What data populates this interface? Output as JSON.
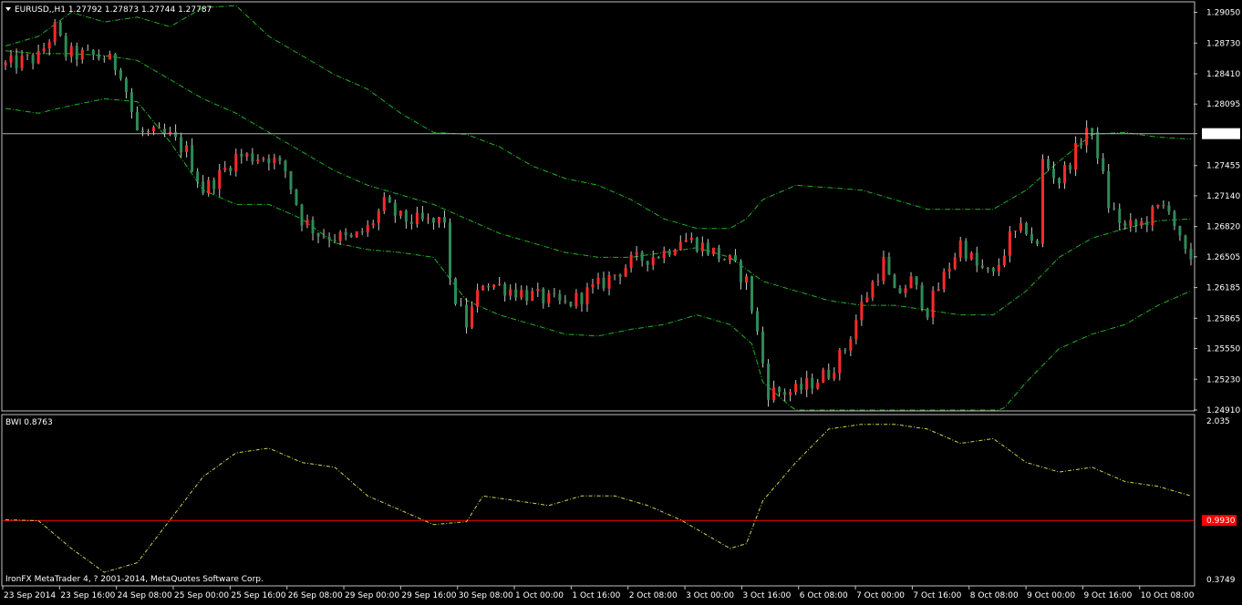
{
  "window": {
    "symbol_header": "EURUSD,,H1  1.27792 1.27873 1.27744 1.27787",
    "indicator_header": "BWI 0.8763",
    "copyright": "IronFX MetaTrader 4, ? 2001-2014, MetaQuotes Software Corp."
  },
  "colors": {
    "background": "#000000",
    "frame": "#c0c0c0",
    "bull_candle": "#ff2a2a",
    "bear_candle": "#2e8b57",
    "wick": "#c8c8c8",
    "bollinger": "#22b022",
    "bwi_line": "#c8d84a",
    "bwi_level": "#ff0000",
    "bid_line": "#b0b0b0"
  },
  "chart_data": [
    {
      "type": "candlestick",
      "title": "EURUSD,,H1",
      "ohlc_header": "1.27792 1.27873 1.27744 1.27787",
      "y_ticks": [
        "1.29050",
        "1.28730",
        "1.28410",
        "1.28095",
        "1.27787",
        "1.27455",
        "1.27140",
        "1.26820",
        "1.26505",
        "1.26185",
        "1.25865",
        "1.25550",
        "1.25230",
        "1.24910"
      ],
      "ylim": [
        1.2491,
        1.2915
      ],
      "current_price": 1.27787,
      "x_ticks": [
        "23 Sep 2014",
        "23 Sep 16:00",
        "24 Sep 08:00",
        "25 Sep 00:00",
        "25 Sep 16:00",
        "26 Sep 08:00",
        "29 Sep 00:00",
        "29 Sep 16:00",
        "30 Sep 08:00",
        "1 Oct 00:00",
        "1 Oct 16:00",
        "2 Oct 08:00",
        "3 Oct 00:00",
        "3 Oct 16:00",
        "6 Oct 08:00",
        "7 Oct 00:00",
        "7 Oct 16:00",
        "8 Oct 08:00",
        "9 Oct 00:00",
        "9 Oct 16:00",
        "10 Oct 08:00"
      ],
      "close_path": [
        [
          0,
          1.285
        ],
        [
          6,
          1.2858
        ],
        [
          9,
          1.2888
        ],
        [
          11,
          1.2862
        ],
        [
          18,
          1.2858
        ],
        [
          21,
          1.2845
        ],
        [
          24,
          1.278
        ],
        [
          30,
          1.2775
        ],
        [
          33,
          1.276
        ],
        [
          36,
          1.272
        ],
        [
          39,
          1.2735
        ],
        [
          42,
          1.2755
        ],
        [
          48,
          1.2755
        ],
        [
          51,
          1.274
        ],
        [
          54,
          1.269
        ],
        [
          57,
          1.2675
        ],
        [
          63,
          1.2668
        ],
        [
          66,
          1.268
        ],
        [
          69,
          1.2705
        ],
        [
          72,
          1.269
        ],
        [
          78,
          1.2685
        ],
        [
          80,
          1.269
        ],
        [
          81,
          1.262
        ],
        [
          84,
          1.258
        ],
        [
          87,
          1.2625
        ],
        [
          96,
          1.261
        ],
        [
          102,
          1.26
        ],
        [
          108,
          1.262
        ],
        [
          114,
          1.2645
        ],
        [
          120,
          1.2655
        ],
        [
          123,
          1.267
        ],
        [
          126,
          1.2665
        ],
        [
          132,
          1.2645
        ],
        [
          135,
          1.2625
        ],
        [
          137,
          1.257
        ],
        [
          139,
          1.251
        ],
        [
          144,
          1.251
        ],
        [
          150,
          1.253
        ],
        [
          153,
          1.2555
        ],
        [
          156,
          1.26
        ],
        [
          160,
          1.2645
        ],
        [
          162,
          1.261
        ],
        [
          165,
          1.2625
        ],
        [
          168,
          1.2595
        ],
        [
          171,
          1.263
        ],
        [
          174,
          1.2665
        ],
        [
          177,
          1.264
        ],
        [
          180,
          1.263
        ],
        [
          183,
          1.267
        ],
        [
          186,
          1.268
        ],
        [
          188,
          1.266
        ],
        [
          189,
          1.275
        ],
        [
          192,
          1.273
        ],
        [
          195,
          1.276
        ],
        [
          197,
          1.2785
        ],
        [
          199,
          1.276
        ],
        [
          201,
          1.2705
        ],
        [
          204,
          1.268
        ],
        [
          207,
          1.2685
        ],
        [
          210,
          1.27
        ],
        [
          212,
          1.2705
        ],
        [
          214,
          1.2665
        ],
        [
          216,
          1.264
        ]
      ],
      "bollinger_upper": [
        [
          0,
          1.287
        ],
        [
          6,
          1.288
        ],
        [
          12,
          1.2905
        ],
        [
          18,
          1.2895
        ],
        [
          24,
          1.29
        ],
        [
          30,
          1.289
        ],
        [
          36,
          1.291
        ],
        [
          42,
          1.2912
        ],
        [
          48,
          1.288
        ],
        [
          54,
          1.286
        ],
        [
          60,
          1.284
        ],
        [
          66,
          1.2825
        ],
        [
          72,
          1.28
        ],
        [
          78,
          1.278
        ],
        [
          84,
          1.2778
        ],
        [
          90,
          1.2765
        ],
        [
          96,
          1.2745
        ],
        [
          102,
          1.2732
        ],
        [
          108,
          1.2725
        ],
        [
          114,
          1.271
        ],
        [
          120,
          1.269
        ],
        [
          126,
          1.268
        ],
        [
          132,
          1.268
        ],
        [
          135,
          1.269
        ],
        [
          138,
          1.271
        ],
        [
          144,
          1.2725
        ],
        [
          156,
          1.272
        ],
        [
          162,
          1.271
        ],
        [
          168,
          1.27
        ],
        [
          174,
          1.27
        ],
        [
          180,
          1.27
        ],
        [
          186,
          1.272
        ],
        [
          192,
          1.275
        ],
        [
          198,
          1.2778
        ],
        [
          204,
          1.278
        ],
        [
          210,
          1.2775
        ],
        [
          216,
          1.2773
        ]
      ],
      "bollinger_middle": [
        [
          0,
          1.2865
        ],
        [
          6,
          1.2862
        ],
        [
          12,
          1.2862
        ],
        [
          18,
          1.286
        ],
        [
          24,
          1.2855
        ],
        [
          30,
          1.2835
        ],
        [
          36,
          1.2815
        ],
        [
          42,
          1.28
        ],
        [
          48,
          1.278
        ],
        [
          54,
          1.276
        ],
        [
          60,
          1.274
        ],
        [
          66,
          1.2725
        ],
        [
          72,
          1.2715
        ],
        [
          78,
          1.2705
        ],
        [
          84,
          1.269
        ],
        [
          90,
          1.2675
        ],
        [
          96,
          1.2665
        ],
        [
          102,
          1.2655
        ],
        [
          108,
          1.265
        ],
        [
          114,
          1.265
        ],
        [
          120,
          1.2655
        ],
        [
          126,
          1.266
        ],
        [
          132,
          1.265
        ],
        [
          138,
          1.2625
        ],
        [
          144,
          1.2615
        ],
        [
          150,
          1.2605
        ],
        [
          156,
          1.26
        ],
        [
          162,
          1.26
        ],
        [
          168,
          1.2595
        ],
        [
          174,
          1.259
        ],
        [
          180,
          1.259
        ],
        [
          186,
          1.2615
        ],
        [
          192,
          1.265
        ],
        [
          198,
          1.267
        ],
        [
          204,
          1.268
        ],
        [
          210,
          1.2688
        ],
        [
          216,
          1.269
        ]
      ],
      "bollinger_lower": [
        [
          0,
          1.2805
        ],
        [
          6,
          1.28
        ],
        [
          12,
          1.2808
        ],
        [
          18,
          1.2815
        ],
        [
          24,
          1.2812
        ],
        [
          30,
          1.277
        ],
        [
          36,
          1.272
        ],
        [
          42,
          1.2705
        ],
        [
          48,
          1.2705
        ],
        [
          54,
          1.269
        ],
        [
          60,
          1.2665
        ],
        [
          66,
          1.2658
        ],
        [
          72,
          1.2655
        ],
        [
          78,
          1.265
        ],
        [
          84,
          1.2605
        ],
        [
          90,
          1.259
        ],
        [
          96,
          1.258
        ],
        [
          102,
          1.257
        ],
        [
          108,
          1.2568
        ],
        [
          114,
          1.2575
        ],
        [
          120,
          1.258
        ],
        [
          126,
          1.259
        ],
        [
          132,
          1.258
        ],
        [
          136,
          1.256
        ],
        [
          138,
          1.252
        ],
        [
          142,
          1.25
        ],
        [
          144,
          1.249
        ],
        [
          150,
          1.248
        ],
        [
          156,
          1.247
        ],
        [
          162,
          1.246
        ],
        [
          168,
          1.2455
        ],
        [
          174,
          1.2458
        ],
        [
          180,
          1.248
        ],
        [
          186,
          1.252
        ],
        [
          192,
          1.2555
        ],
        [
          198,
          1.257
        ],
        [
          204,
          1.258
        ],
        [
          210,
          1.26
        ],
        [
          216,
          1.2615
        ]
      ]
    },
    {
      "type": "line",
      "title": "BWI 0.8763",
      "y_ticks": [
        "2.035",
        "0.9930",
        "0.3749"
      ],
      "ylim": [
        0.3749,
        2.035
      ],
      "level": 0.993,
      "series": [
        {
          "name": "BWI",
          "points": [
            [
              0,
              1.0
            ],
            [
              6,
              0.99
            ],
            [
              12,
              0.7
            ],
            [
              18,
              0.45
            ],
            [
              24,
              0.55
            ],
            [
              30,
              1.0
            ],
            [
              36,
              1.45
            ],
            [
              42,
              1.7
            ],
            [
              48,
              1.75
            ],
            [
              54,
              1.6
            ],
            [
              60,
              1.55
            ],
            [
              66,
              1.25
            ],
            [
              72,
              1.1
            ],
            [
              78,
              0.95
            ],
            [
              84,
              0.98
            ],
            [
              87,
              1.25
            ],
            [
              93,
              1.2
            ],
            [
              99,
              1.15
            ],
            [
              105,
              1.25
            ],
            [
              111,
              1.25
            ],
            [
              117,
              1.15
            ],
            [
              123,
              1.0
            ],
            [
              129,
              0.8
            ],
            [
              132,
              0.7
            ],
            [
              135,
              0.75
            ],
            [
              138,
              1.2
            ],
            [
              144,
              1.6
            ],
            [
              150,
              1.95
            ],
            [
              156,
              2.0
            ],
            [
              162,
              2.0
            ],
            [
              168,
              1.95
            ],
            [
              174,
              1.8
            ],
            [
              180,
              1.85
            ],
            [
              186,
              1.6
            ],
            [
              192,
              1.5
            ],
            [
              198,
              1.55
            ],
            [
              204,
              1.4
            ],
            [
              210,
              1.35
            ],
            [
              216,
              1.25
            ]
          ]
        }
      ]
    }
  ]
}
